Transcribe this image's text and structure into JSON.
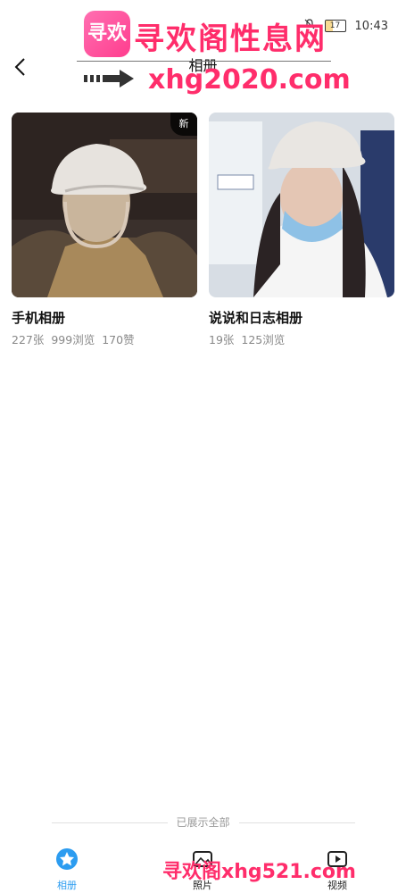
{
  "status": {
    "time": "10:43",
    "battery": "17"
  },
  "watermark": {
    "logo": "寻欢",
    "title": "寻欢阁性息网",
    "url": "xhg2020.com",
    "bottom": "寻欢阁xhg521.com"
  },
  "header": {
    "title": "相册",
    "back_icon": "chevron-left-icon"
  },
  "albums": [
    {
      "title": "手机相册",
      "count": "227张",
      "views": "999浏览",
      "likes": "170赞",
      "badge": "新"
    },
    {
      "title": "说说和日志相册",
      "count": "19张",
      "views": "125浏览"
    }
  ],
  "footer": {
    "text": "已展示全部"
  },
  "nav": [
    {
      "label": "相册",
      "icon": "album-icon",
      "active": true
    },
    {
      "label": "照片",
      "icon": "photo-icon",
      "active": false
    },
    {
      "label": "视频",
      "icon": "video-icon",
      "active": false
    }
  ],
  "colors": {
    "accent": "#2c9cf0",
    "watermark": "#ff2d6b",
    "muted": "#888888"
  }
}
